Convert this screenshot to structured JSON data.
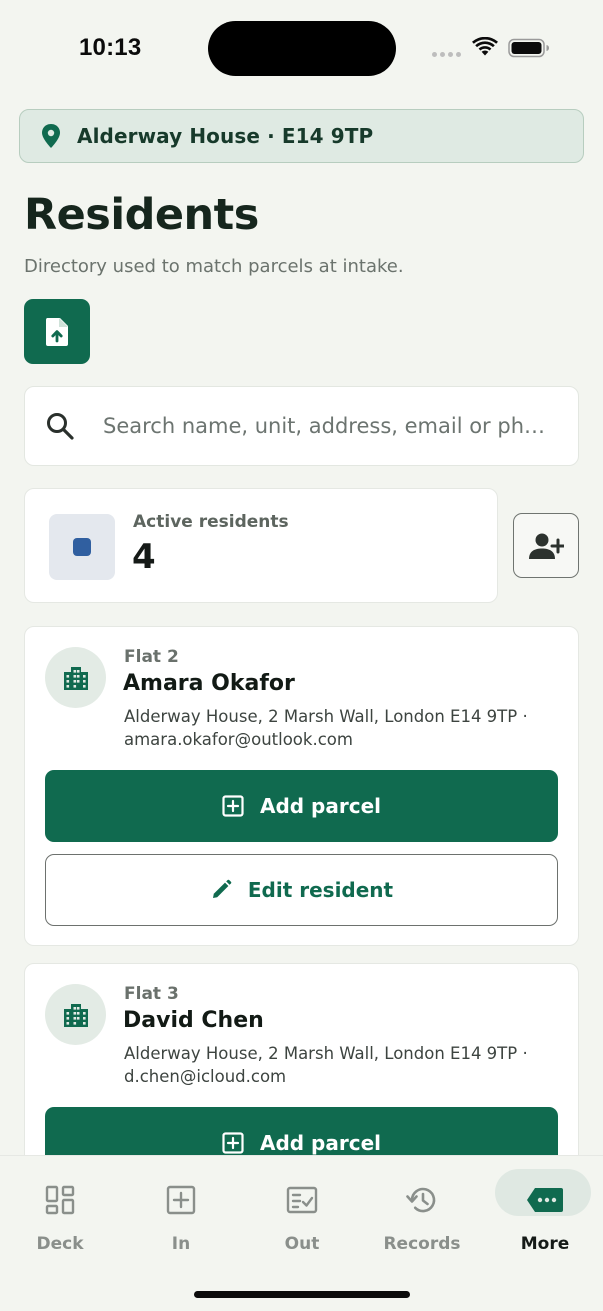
{
  "status_bar": {
    "time": "10:13"
  },
  "location": {
    "label": "Alderway House · E14 9TP"
  },
  "header": {
    "title": "Residents",
    "subtitle": "Directory used to match parcels at intake."
  },
  "search": {
    "placeholder": "Search name, unit, address, email or ph…"
  },
  "stats": {
    "label": "Active residents",
    "value": "4",
    "swatch_color": "#305fa0"
  },
  "residents": [
    {
      "unit": "Flat 2",
      "name": "Amara Okafor",
      "address": "Alderway House, 2 Marsh Wall, London E14 9TP · amara.okafor@outlook.com",
      "add_label": "Add parcel",
      "edit_label": "Edit resident"
    },
    {
      "unit": "Flat 3",
      "name": "David Chen",
      "address": "Alderway House, 2 Marsh Wall, London E14 9TP · d.chen@icloud.com",
      "add_label": "Add parcel"
    }
  ],
  "tabs": [
    {
      "label": "Deck",
      "icon": "dashboard-icon"
    },
    {
      "label": "In",
      "icon": "plus-square-icon"
    },
    {
      "label": "Out",
      "icon": "checklist-icon"
    },
    {
      "label": "Records",
      "icon": "history-icon"
    },
    {
      "label": "More",
      "icon": "ticket-icon",
      "active": true
    }
  ],
  "colors": {
    "primary": "#106a4f",
    "background": "#f3f5f0",
    "banner": "#dfeae3"
  }
}
